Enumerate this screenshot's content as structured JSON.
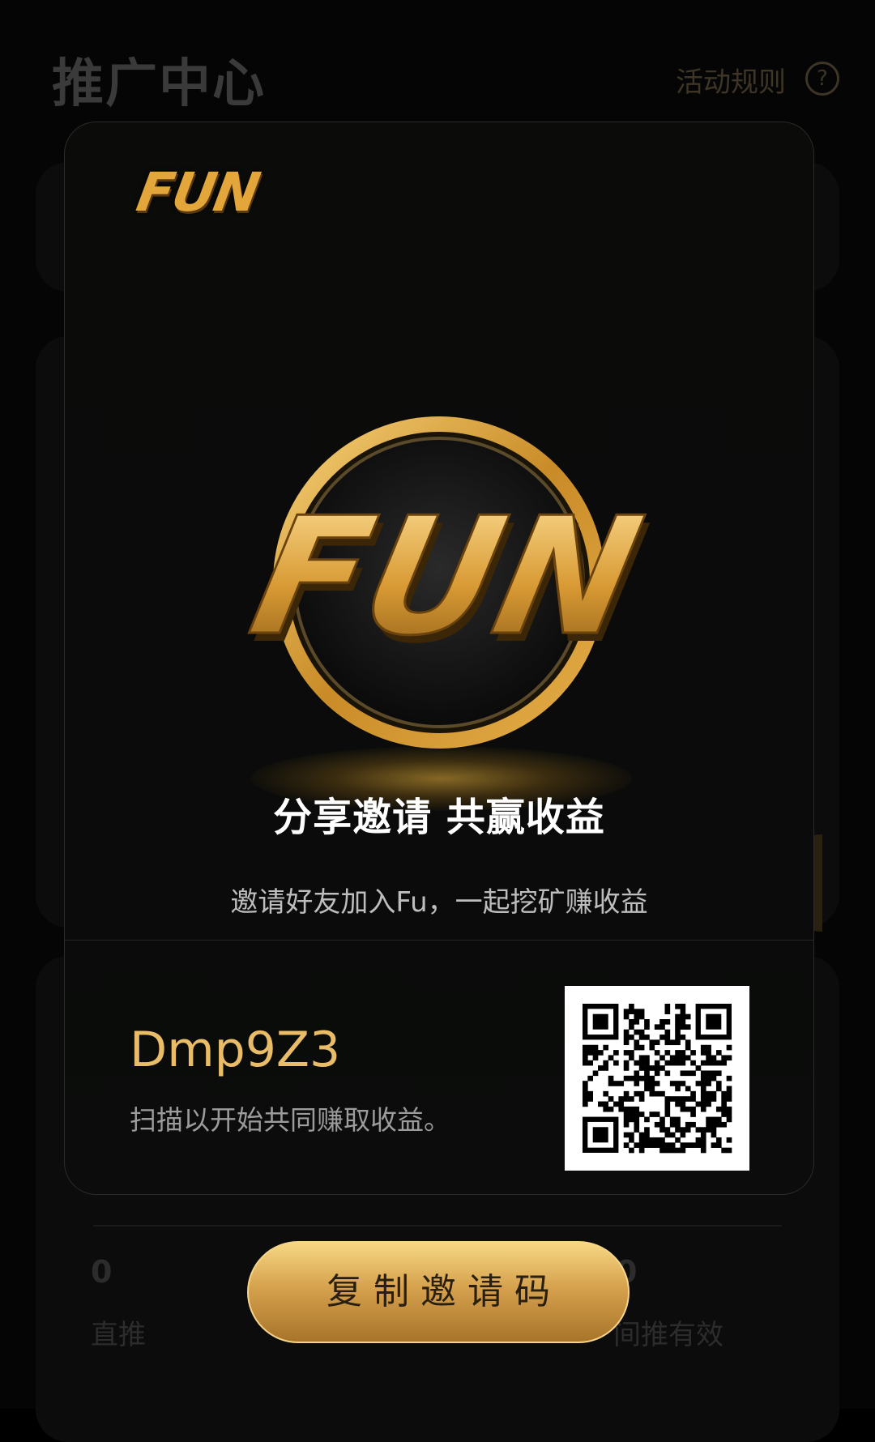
{
  "background_page": {
    "title": "推广中心",
    "rules_link": "活动规则",
    "help_icon_glyph": "?",
    "stats": [
      {
        "value": "0",
        "label": "直推"
      },
      {
        "value": "0",
        "label": "间推有效"
      }
    ]
  },
  "modal": {
    "brand_small": "FUN",
    "hero_logo_text": "FUN",
    "headline": "分享邀请 共赢收益",
    "subline": "邀请好友加入Fu，一起挖矿赚收益",
    "invite_code": "Dmp9Z3",
    "scan_text": "扫描以开始共同赚取收益。"
  },
  "copy_button": {
    "label": "复制邀请码"
  },
  "colors": {
    "gold": "#e9bc68",
    "gold_bright": "#f7d783",
    "gold_dark": "#a8742a",
    "background": "#000000"
  }
}
